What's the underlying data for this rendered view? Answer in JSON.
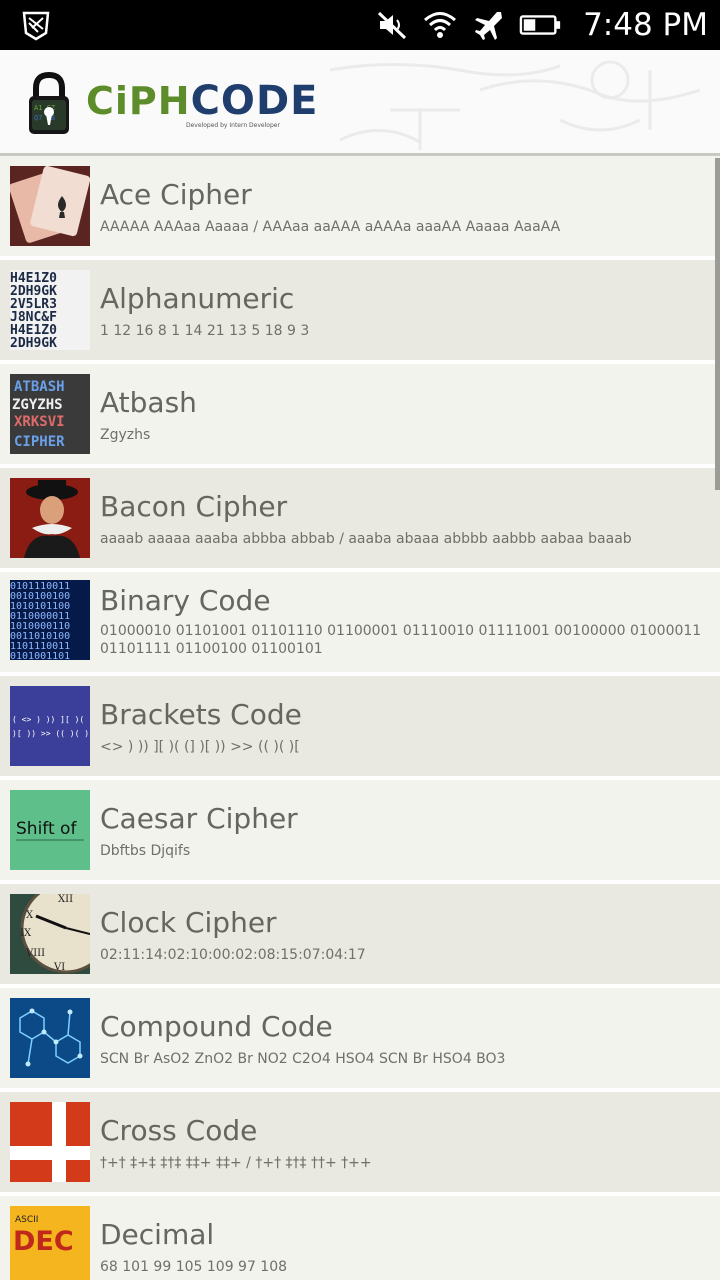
{
  "status_bar": {
    "time": "7:48 PM",
    "icons": [
      "app-shield-icon",
      "mute-icon",
      "wifi-icon",
      "airplane-icon",
      "battery-icon"
    ]
  },
  "header": {
    "logo_part1": "CiPH",
    "logo_part2": "CODE",
    "logo_subtitle": "Developed by Intern Developer"
  },
  "colors": {
    "logo_green": "#5d8d2a",
    "logo_blue": "#1f3e6e",
    "row_light": "#f3f3ee",
    "row_dark": "#e9e9e1",
    "title_text": "#666660"
  },
  "items": [
    {
      "title": "Ace Cipher",
      "example": "AAAAA AAAaa Aaaaa / AAAaa aaAAA aAAAa aaaAA Aaaaa AaaAA",
      "icon": "ace-card-icon"
    },
    {
      "title": "Alphanumeric",
      "example": "1 12 16 8 1 14 21 13 5 18 9 3",
      "icon": "alphanumeric-icon"
    },
    {
      "title": "Atbash",
      "example": "Zgyzhs",
      "icon": "atbash-icon"
    },
    {
      "title": "Bacon Cipher",
      "example": "aaaab aaaaa aaaba abbba abbab / aaaba abaaa abbbb aabbb aabaa baaab",
      "icon": "bacon-portrait-icon"
    },
    {
      "title": "Binary Code",
      "example": "01000010 01101001 01101110 01100001 01110010 01111001 00100000 01000011 01101111 01100100 01100101",
      "icon": "binary-icon"
    },
    {
      "title": "Brackets Code",
      "example": "<> ) )) ][ )( (] )[ )) >> (( )( )[",
      "icon": "brackets-icon"
    },
    {
      "title": "Caesar Cipher",
      "example": "Dbftbs Djqifs",
      "icon": "caesar-shift-icon"
    },
    {
      "title": "Clock Cipher",
      "example": "02:11:14:02:10:00:02:08:15:07:04:17",
      "icon": "clock-icon"
    },
    {
      "title": "Compound Code",
      "example": "SCN Br AsO2 ZnO2 Br NO2 C2O4 HSO4  SCN Br HSO4 BO3",
      "icon": "molecule-icon"
    },
    {
      "title": "Cross Code",
      "example": "†+† ‡+‡ ‡†‡ ‡‡+ ‡‡+ / †+† ‡†‡ ††+ †++",
      "icon": "cross-flag-icon"
    },
    {
      "title": "Decimal",
      "example": "68 101 99 105 109 97 108",
      "icon": "ascii-dec-icon"
    }
  ],
  "thumb_text": {
    "atbash": [
      "ATBASH",
      "ZGYZHS",
      "XRKSVI",
      "CIPHER"
    ],
    "brackets": [
      "( <> ) )) ][ )( (]",
      ")[ )) >> (( )( )["
    ],
    "caesar": "Shift of",
    "decimal_top": "ASCII",
    "decimal_main": "DEC"
  }
}
